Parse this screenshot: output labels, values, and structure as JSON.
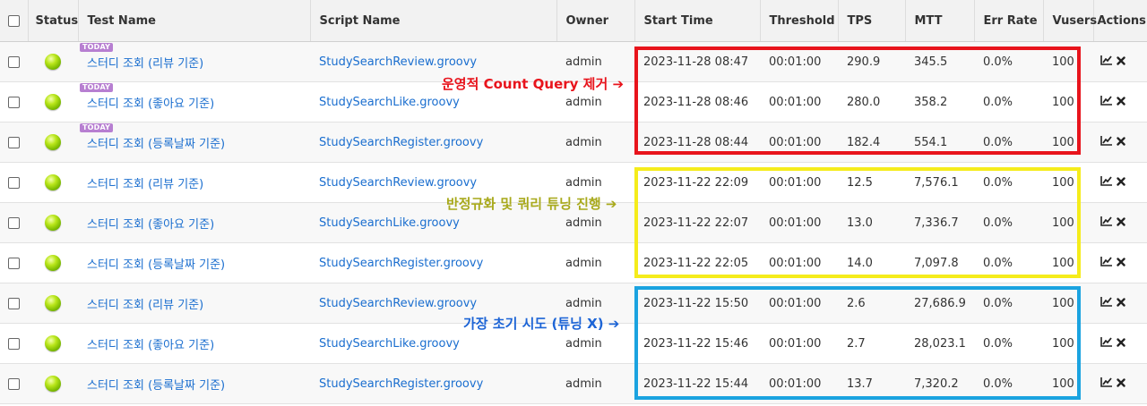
{
  "columns": {
    "status": "Status",
    "test_name": "Test Name",
    "script_name": "Script Name",
    "owner": "Owner",
    "start_time": "Start Time",
    "threshold": "Threshold",
    "tps": "TPS",
    "mtt": "MTT",
    "err_rate": "Err Rate",
    "vusers": "Vusers",
    "actions": "Actions"
  },
  "rows": [
    {
      "today": "TODAY",
      "test_name": "스터디 조회 (리뷰 기준)",
      "script_name": "StudySearchReview.groovy",
      "owner": "admin",
      "start_time": "2023-11-28 08:47",
      "threshold": "00:01:00",
      "tps": "290.9",
      "mtt": "345.5",
      "err_rate": "0.0%",
      "vusers": "100"
    },
    {
      "today": "TODAY",
      "test_name": "스터디 조회 (좋아요 기준)",
      "script_name": "StudySearchLike.groovy",
      "owner": "admin",
      "start_time": "2023-11-28 08:46",
      "threshold": "00:01:00",
      "tps": "280.0",
      "mtt": "358.2",
      "err_rate": "0.0%",
      "vusers": "100"
    },
    {
      "today": "TODAY",
      "test_name": "스터디 조회 (등록날짜 기준)",
      "script_name": "StudySearchRegister.groovy",
      "owner": "admin",
      "start_time": "2023-11-28 08:44",
      "threshold": "00:01:00",
      "tps": "182.4",
      "mtt": "554.1",
      "err_rate": "0.0%",
      "vusers": "100"
    },
    {
      "today": "",
      "test_name": "스터디 조회 (리뷰 기준)",
      "script_name": "StudySearchReview.groovy",
      "owner": "admin",
      "start_time": "2023-11-22 22:09",
      "threshold": "00:01:00",
      "tps": "12.5",
      "mtt": "7,576.1",
      "err_rate": "0.0%",
      "vusers": "100"
    },
    {
      "today": "",
      "test_name": "스터디 조회 (좋아요 기준)",
      "script_name": "StudySearchLike.groovy",
      "owner": "admin",
      "start_time": "2023-11-22 22:07",
      "threshold": "00:01:00",
      "tps": "13.0",
      "mtt": "7,336.7",
      "err_rate": "0.0%",
      "vusers": "100"
    },
    {
      "today": "",
      "test_name": "스터디 조회 (등록날짜 기준)",
      "script_name": "StudySearchRegister.groovy",
      "owner": "admin",
      "start_time": "2023-11-22 22:05",
      "threshold": "00:01:00",
      "tps": "14.0",
      "mtt": "7,097.8",
      "err_rate": "0.0%",
      "vusers": "100"
    },
    {
      "today": "",
      "test_name": "스터디 조회 (리뷰 기준)",
      "script_name": "StudySearchReview.groovy",
      "owner": "admin",
      "start_time": "2023-11-22 15:50",
      "threshold": "00:01:00",
      "tps": "2.6",
      "mtt": "27,686.9",
      "err_rate": "0.0%",
      "vusers": "100"
    },
    {
      "today": "",
      "test_name": "스터디 조회 (좋아요 기준)",
      "script_name": "StudySearchLike.groovy",
      "owner": "admin",
      "start_time": "2023-11-22 15:46",
      "threshold": "00:01:00",
      "tps": "2.7",
      "mtt": "28,023.1",
      "err_rate": "0.0%",
      "vusers": "100"
    },
    {
      "today": "",
      "test_name": "스터디 조회 (등록날짜 기준)",
      "script_name": "StudySearchRegister.groovy",
      "owner": "admin",
      "start_time": "2023-11-22 15:44",
      "threshold": "00:01:00",
      "tps": "13.7",
      "mtt": "7,320.2",
      "err_rate": "0.0%",
      "vusers": "100"
    }
  ],
  "annotations": [
    {
      "text": "운영적 Count Query 제거 ➔",
      "color": "#e8141c"
    },
    {
      "text": "반정규화 및 쿼리 튜닝 진행 ➔",
      "color": "#a8a91c",
      "box_color": "#f5ec1b"
    },
    {
      "text": "가장 초기 시도 (튜닝 X) ➔",
      "color": "#1c64d6",
      "box_color": "#1ba3e0"
    }
  ],
  "icons": {
    "status": "green-ball-icon",
    "report": "trend-chart-icon",
    "delete": "close-x-icon"
  }
}
